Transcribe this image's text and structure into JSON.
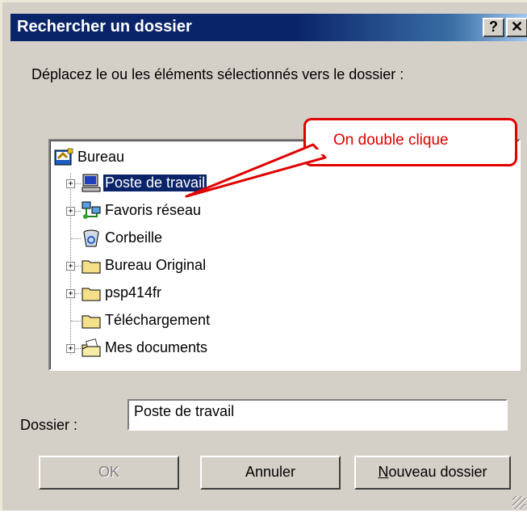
{
  "window": {
    "title": "Rechercher un dossier",
    "help_button": "?",
    "close_button": "✕"
  },
  "prompt": "Déplacez le ou les  éléments sélectionnés vers le dossier :",
  "tree": {
    "root": {
      "label": "Bureau",
      "icon": "desktop-icon"
    },
    "items": [
      {
        "label": "Poste de travail",
        "icon": "computer-icon",
        "expandable": true,
        "selected": true
      },
      {
        "label": "Favoris réseau",
        "icon": "network-icon",
        "expandable": true,
        "selected": false
      },
      {
        "label": "Corbeille",
        "icon": "recycle-bin-icon",
        "expandable": false,
        "selected": false
      },
      {
        "label": "Bureau Original",
        "icon": "folder-icon",
        "expandable": true,
        "selected": false
      },
      {
        "label": "psp414fr",
        "icon": "folder-icon",
        "expandable": true,
        "selected": false
      },
      {
        "label": "Téléchargement",
        "icon": "folder-icon",
        "expandable": false,
        "selected": false
      },
      {
        "label": "Mes documents",
        "icon": "documents-folder-icon",
        "expandable": true,
        "selected": false
      }
    ]
  },
  "annotation": {
    "text": "On double clique",
    "color": "#e00000"
  },
  "folder": {
    "label": "Dossier :",
    "value": "Poste de travail"
  },
  "buttons": {
    "ok": "OK",
    "cancel": "Annuler",
    "new_folder": "Nouveau dossier"
  },
  "colors": {
    "title_bar": "#0a246a",
    "selection": "#0a246a",
    "dialog_face": "#d4d0c8"
  }
}
